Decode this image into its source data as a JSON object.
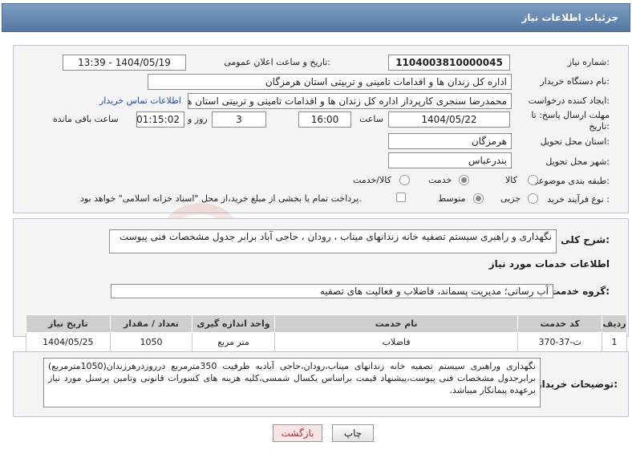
{
  "header": {
    "title": "جزئیات اطلاعات نیاز"
  },
  "form": {
    "need_number_label": "شماره نیاز:",
    "need_number": "1104003810000045",
    "announce_label": "تاریخ و ساعت اعلان عمومی:",
    "announce_value": "1404/05/19 - 13:39",
    "buyer_org_label": "نام دستگاه خریدار:",
    "buyer_org": "اداره کل زندان ها و اقدامات تامینی و تربیتی استان هرمزگان",
    "requester_label": "ایجاد کننده درخواست:",
    "requester": "محمدرضا سنجری کارپرداز اداره کل زندان ها و اقدامات تامینی و تربیتی استان هر",
    "contact_link": "اطلاعات تماس خریدار",
    "deadline_label_1": "مهلت ارسال پاسخ: تا",
    "deadline_label_2": "تاریخ:",
    "deadline_date": "1404/05/22",
    "time_label": "ساعت",
    "deadline_time": "16:00",
    "days_value": "3",
    "days_label": "روز و",
    "remaining_time": "01:15:02",
    "remaining_label": "ساعت باقی مانده",
    "province_label": "استان محل تحویل:",
    "province": "هرمزگان",
    "city_label": "شهر محل تحویل:",
    "city": "بندرعباس",
    "category_label": "طبقه بندی موضوعی:",
    "category_options": [
      "کالا",
      "خدمت",
      "کالا/خدمت"
    ],
    "category_selected": "خدمت",
    "process_label": "نوع فرآیند خرید :",
    "process_options": [
      "جزیی",
      "متوسط"
    ],
    "process_selected": "متوسط",
    "payment_note": "پرداخت تمام یا بخشی از مبلغ خرید،از محل \"اسناد خزانه اسلامی\" خواهد بود."
  },
  "summary": {
    "label": "شرح کلی نیاز:",
    "text": "نگهداری و راهبری سیستم تصفیه خانه زندانهای میناب ، رودان ، حاجی آباد برابر جدول مشخصات فنی پیوست"
  },
  "services": {
    "section_title": "اطلاعات خدمات مورد نیاز",
    "group_label": "گروه خدمت:",
    "group_value": "آب رسانی؛ مدیریت پسماند، فاضلاب و فعالیت های تصفیه",
    "columns": [
      "ردیف",
      "کد خدمت",
      "نام خدمت",
      "واحد اندازه گیری",
      "تعداد / مقدار",
      "تاریخ نیاز"
    ],
    "rows": [
      [
        "1",
        "ث-37-370",
        "فاضلاب",
        "متر مربع",
        "1050",
        "1404/05/25"
      ]
    ]
  },
  "buyer_notes": {
    "label": "توضیحات خریدار:",
    "text": "نگهداری وراهبری سیستم تصفیه خانه زندانهای میناب،رودان،حاجی آبادبه ظرفیت 350مترمربع درروزدرهرزندان(1050مترمربع) برابرجدول مشخصات فنی پیوست،پیشنهاد قیمت براساس یکسال شمسی،کلیه هزینه های کسورات قانونی وتامین پرسنل مورد نیاز برعهده پیمانکار میباشد."
  },
  "buttons": {
    "print": "چاپ",
    "back": "بازگشت"
  },
  "colors": {
    "header": "#6389b4",
    "link": "#1a4bb3",
    "back_button_bg": "#f7e4e4"
  }
}
